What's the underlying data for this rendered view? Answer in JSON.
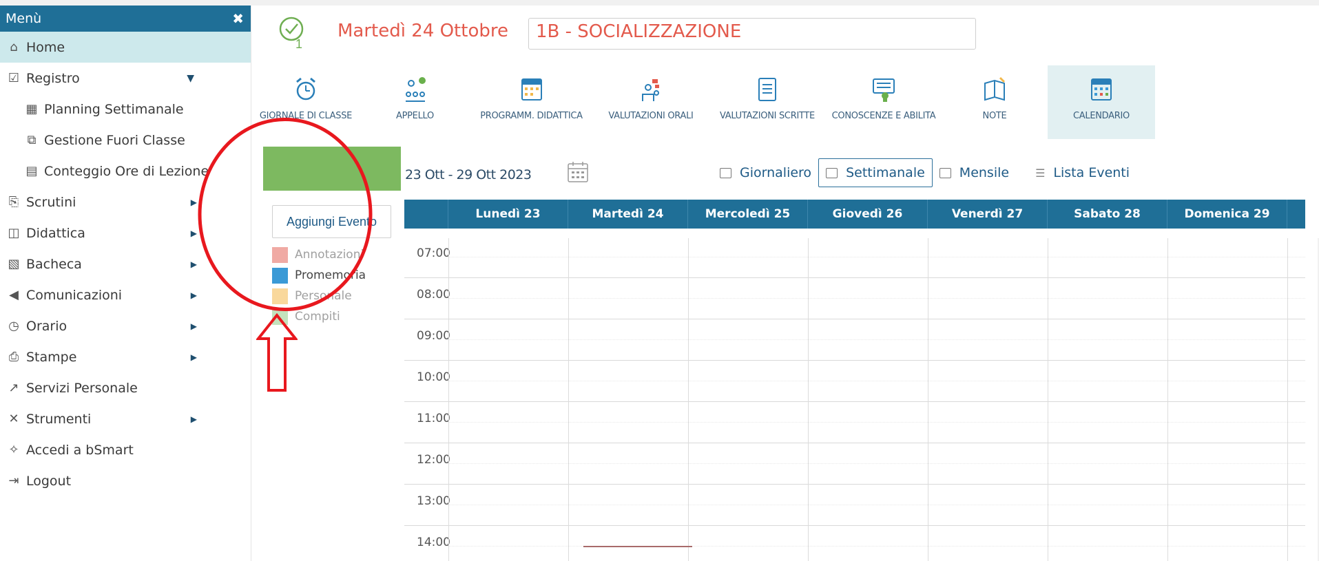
{
  "sidebar": {
    "title": "Menù",
    "close_icon": "✖",
    "items": [
      {
        "label": "Home",
        "icon": "home-icon",
        "glyph": "⌂"
      },
      {
        "label": "Registro",
        "icon": "checkbox-icon",
        "glyph": "☑"
      },
      {
        "label": "Planning Settimanale",
        "icon": "calendar-icon",
        "glyph": "▦"
      },
      {
        "label": "Gestione Fuori Classe",
        "icon": "external-link-icon",
        "glyph": "⧉"
      },
      {
        "label": "Conteggio Ore di Lezione",
        "icon": "calculator-icon",
        "glyph": "▤"
      },
      {
        "label": "Scrutini",
        "icon": "scrutini-icon",
        "glyph": "⎘"
      },
      {
        "label": "Didattica",
        "icon": "book-icon",
        "glyph": "◫"
      },
      {
        "label": "Bacheca",
        "icon": "newspaper-icon",
        "glyph": "▧"
      },
      {
        "label": "Comunicazioni",
        "icon": "megaphone-icon",
        "glyph": "◀"
      },
      {
        "label": "Orario",
        "icon": "clock-icon",
        "glyph": "◷"
      },
      {
        "label": "Stampe",
        "icon": "printer-icon",
        "glyph": "⎙"
      },
      {
        "label": "Servizi Personale",
        "icon": "share-icon",
        "glyph": "↗"
      },
      {
        "label": "Strumenti",
        "icon": "tools-icon",
        "glyph": "✕"
      },
      {
        "label": "Accedi a bSmart",
        "icon": "bsmart-icon",
        "glyph": "✧"
      },
      {
        "label": "Logout",
        "icon": "logout-icon",
        "glyph": "⇥"
      }
    ]
  },
  "header": {
    "date": "Martedì 24 Ottobre",
    "class_name": "1B - SOCIALIZZAZIONE",
    "check_badge": "1"
  },
  "toolbar": [
    {
      "label": "GIORNALE DI CLASSE",
      "icon": "alarm-clock-icon"
    },
    {
      "label": "APPELLO",
      "icon": "attendance-icon"
    },
    {
      "label": "PROGRAMM. DIDATTICA",
      "icon": "calendar-plan-icon"
    },
    {
      "label": "VALUTAZIONI ORALI",
      "icon": "oral-grades-icon"
    },
    {
      "label": "VALUTAZIONI SCRITTE",
      "icon": "written-grades-icon"
    },
    {
      "label": "CONOSCENZE E ABILITA",
      "icon": "skills-icon"
    },
    {
      "label": "NOTE",
      "icon": "notes-icon"
    },
    {
      "label": "CALENDARIO",
      "icon": "calendar-icon"
    }
  ],
  "calendar": {
    "add_event_label": "Aggiungi Evento",
    "week_range": "23 Ott - 29 Ott 2023",
    "legend": [
      {
        "label": "Annotazioni",
        "color": "#f0aaa4",
        "text_color": "#a0a0a0"
      },
      {
        "label": "Promemoria",
        "color": "#3b9ad6",
        "text_color": "#444444"
      },
      {
        "label": "Personale",
        "color": "#f9d89c",
        "text_color": "#a0a0a0"
      },
      {
        "label": "Compiti",
        "color": "#c4e2bd",
        "text_color": "#a0a0a0"
      }
    ],
    "views": {
      "daily": "Giornaliero",
      "weekly": "Settimanale",
      "monthly": "Mensile",
      "list": "Lista Eventi"
    },
    "days": [
      "Lunedì 23",
      "Martedì 24",
      "Mercoledì 25",
      "Giovedì 26",
      "Venerdì 27",
      "Sabato 28",
      "Domenica 29"
    ],
    "hours": [
      "07:00",
      "08:00",
      "09:00",
      "10:00",
      "11:00",
      "12:00",
      "13:00",
      "14:00"
    ]
  },
  "colors": {
    "brand": "#1f6f97",
    "accent_red": "#e35a4c",
    "green": "#7db960",
    "annotation_red": "#e8181e"
  }
}
